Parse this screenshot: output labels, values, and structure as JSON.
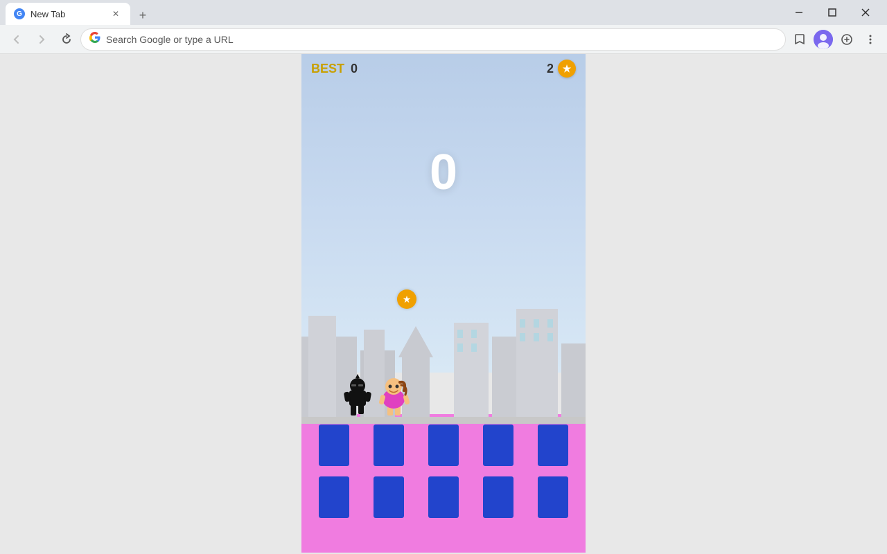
{
  "browser": {
    "tab": {
      "title": "New Tab",
      "favicon_letter": "G"
    },
    "address_bar": {
      "placeholder": "Search Google or type a URL",
      "value": "Search Google or type a URL"
    },
    "window_controls": {
      "minimize": "─",
      "maximize": "□",
      "close": "✕"
    }
  },
  "game": {
    "hud": {
      "best_label": "BEST",
      "best_value": "0",
      "coins_value": "2"
    },
    "score": "0",
    "coin_star": "★"
  }
}
